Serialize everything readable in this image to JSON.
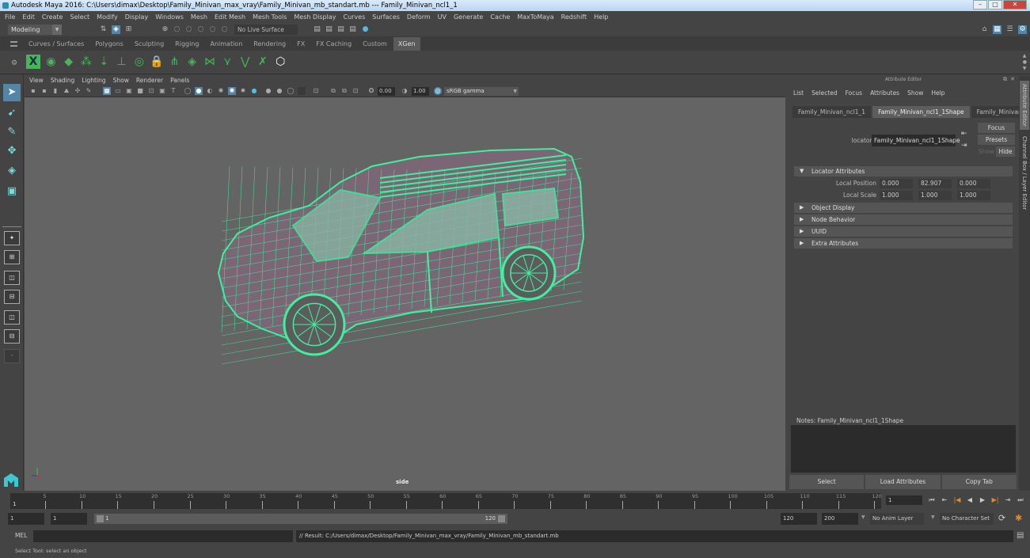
{
  "window": {
    "title": "Autodesk Maya 2016: C:\\Users\\dimax\\Desktop\\Family_Minivan_max_vray\\Family_Minivan_mb_standart.mb   ---   Family_Minivan_ncl1_1",
    "controls": {
      "minimize": "–",
      "maximize": "□",
      "close": "✕"
    }
  },
  "menubar": [
    "File",
    "Edit",
    "Create",
    "Select",
    "Modify",
    "Display",
    "Windows",
    "Mesh",
    "Edit Mesh",
    "Mesh Tools",
    "Mesh Display",
    "Curves",
    "Surfaces",
    "Deform",
    "UV",
    "Generate",
    "Cache",
    "MaxToMaya",
    "Redshift",
    "Help"
  ],
  "statusline": {
    "mode": "Modeling",
    "live_surface": "No Live Surface"
  },
  "shelf": {
    "tabs": [
      "Curves / Surfaces",
      "Polygons",
      "Sculpting",
      "Rigging",
      "Animation",
      "Rendering",
      "FX",
      "FX Caching",
      "Custom",
      "XGen"
    ],
    "active_tab": "XGen",
    "icons": [
      "xgen-description-editor-icon",
      "xgen-preview-icon",
      "xgen-hide-icon",
      "xgen-add-guides-icon",
      "xgen-sculpt-guides-icon",
      "xgen-add-guide-icon",
      "xgen-view-guide-icon",
      "xgen-lock-guide-icon",
      "xgen-grass-icon",
      "xgen-layer-icon",
      "xgen-rebuild-icon",
      "xgen-select-guides-icon",
      "xgen-normalize-icon",
      "xgen-delete-guide-icon",
      "xgen-igs-icon"
    ]
  },
  "panel": {
    "menu": [
      "View",
      "Shading",
      "Lighting",
      "Show",
      "Renderer",
      "Panels"
    ],
    "exposure": "0.00",
    "gamma": "1.00",
    "color_space": "sRGB gamma",
    "camera_label": "side",
    "wire_color": "#3ef0a0",
    "bg_color": "#646464"
  },
  "attribute_editor": {
    "title": "Attribute Editor",
    "menu": [
      "List",
      "Selected",
      "Focus",
      "Attributes",
      "Show",
      "Help"
    ],
    "tabs": [
      "Family_Minivan_ncl1_1",
      "Family_Minivan_ncl1_1Shape",
      "Family_Minivan"
    ],
    "active_tab": "Family_Minivan_ncl1_1Shape",
    "node_type_label": "locator:",
    "node_name": "Family_Minivan_ncl1_1Shape",
    "buttons": {
      "focus": "Focus",
      "presets": "Presets",
      "show": "Show",
      "hide": "Hide"
    },
    "sections": [
      {
        "label": "Locator Attributes",
        "expanded": true
      },
      {
        "label": "Object Display",
        "expanded": false
      },
      {
        "label": "Node Behavior",
        "expanded": false
      },
      {
        "label": "UUID",
        "expanded": false
      },
      {
        "label": "Extra Attributes",
        "expanded": false
      }
    ],
    "attributes": [
      {
        "label": "Local Position",
        "values": [
          "0.000",
          "82.907",
          "0.000"
        ]
      },
      {
        "label": "Local Scale",
        "values": [
          "1.000",
          "1.000",
          "1.000"
        ]
      }
    ],
    "notes_label": "Notes:  Family_Minivan_ncl1_1Shape",
    "notes_value": "",
    "bottom_buttons": [
      "Select",
      "Load Attributes",
      "Copy Tab"
    ],
    "side_tabs": [
      "Attribute Editor",
      "Channel Box / Layer Editor"
    ]
  },
  "timeline": {
    "ticks": [
      5,
      10,
      15,
      20,
      25,
      30,
      35,
      40,
      45,
      50,
      55,
      60,
      65,
      70,
      75,
      80,
      85,
      90,
      95,
      100,
      105,
      110,
      115,
      120
    ],
    "start_marker": "1",
    "current_frame": "1",
    "range_start": "1",
    "playback_start": "1",
    "range_slider_start": "1",
    "range_slider_end": "120",
    "playback_end": "120",
    "range_end": "200",
    "anim_layer": "No Anim Layer",
    "character_set": "No Character Set",
    "playback_buttons": [
      "go-to-start",
      "step-back-key",
      "step-back-frame",
      "play-backwards",
      "play-forwards",
      "step-forward-frame",
      "step-forward-key",
      "go-to-end"
    ]
  },
  "command_line": {
    "language": "MEL",
    "input": "",
    "result": "// Result: C:/Users/dimax/Desktop/Family_Minivan_max_vray/Family_Minivan_mb_standart.mb"
  },
  "help_line": "Select Tool: select an object"
}
